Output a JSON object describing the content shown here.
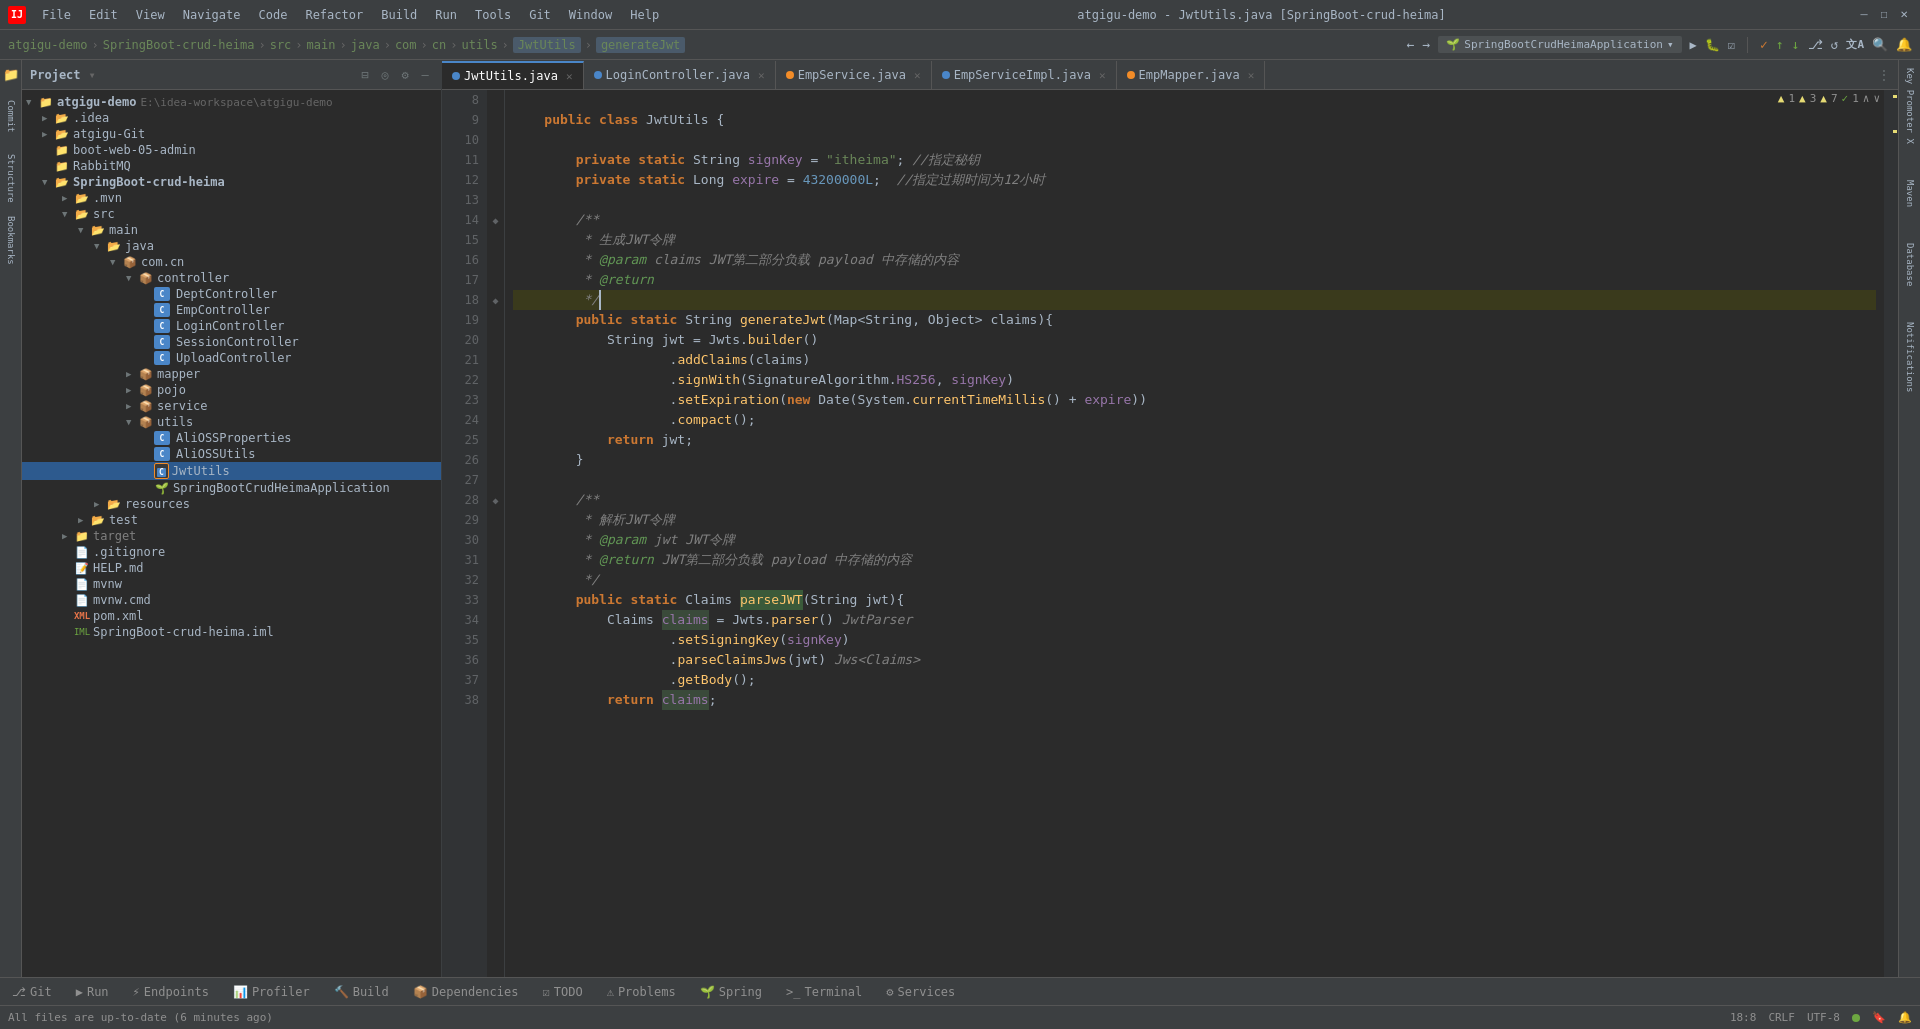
{
  "titlebar": {
    "title": "atgigu-demo - JwtUtils.java [SpringBoot-crud-heima]",
    "menu": [
      "File",
      "Edit",
      "View",
      "Navigate",
      "Code",
      "Refactor",
      "Build",
      "Run",
      "Tools",
      "Git",
      "Window",
      "Help"
    ]
  },
  "breadcrumb": {
    "items": [
      "atgigu-demo",
      "SpringBoot-crud-heima",
      "src",
      "main",
      "java",
      "com",
      "cn",
      "utils",
      "JwtUtils",
      "generateJwt"
    ],
    "run_config": "SpringBootCrudHeimaApplication"
  },
  "tabs": [
    {
      "name": "JwtUtils.java",
      "type": "java",
      "active": true
    },
    {
      "name": "LoginController.java",
      "type": "java",
      "active": false
    },
    {
      "name": "EmpService.java",
      "type": "java",
      "active": false
    },
    {
      "name": "EmpServiceImpl.java",
      "type": "java",
      "active": false
    },
    {
      "name": "EmpMapper.java",
      "type": "java",
      "active": false
    }
  ],
  "warnings": {
    "warn1": "▲ 1",
    "warn3": "▲ 3",
    "warn7": "▲ 7",
    "check1": "✓ 1"
  },
  "project": {
    "title": "Project",
    "root": "atgigu-demo",
    "root_path": "E:\\idea-workspace\\atgigu-demo"
  },
  "tree": [
    {
      "indent": 0,
      "arrow": "▼",
      "icon": "project",
      "label": "atgigu-demo",
      "extra": "E:\\idea-workspace\\atgigu-demo",
      "type": "root"
    },
    {
      "indent": 1,
      "arrow": "▶",
      "icon": "folder",
      "label": ".idea",
      "type": "folder"
    },
    {
      "indent": 1,
      "arrow": "▶",
      "icon": "folder",
      "label": "atgigu-Git",
      "type": "folder"
    },
    {
      "indent": 1,
      "arrow": "",
      "icon": "folder",
      "label": "boot-web-05-admin",
      "type": "folder"
    },
    {
      "indent": 1,
      "arrow": "",
      "icon": "folder",
      "label": "RabbitMQ",
      "type": "folder"
    },
    {
      "indent": 1,
      "arrow": "▼",
      "icon": "folder",
      "label": "SpringBoot-crud-heima",
      "type": "folder"
    },
    {
      "indent": 2,
      "arrow": "▶",
      "icon": "folder",
      "label": ".mvn",
      "type": "folder"
    },
    {
      "indent": 2,
      "arrow": "▼",
      "icon": "folder",
      "label": "src",
      "type": "folder"
    },
    {
      "indent": 3,
      "arrow": "▼",
      "icon": "folder",
      "label": "main",
      "type": "folder"
    },
    {
      "indent": 4,
      "arrow": "▼",
      "icon": "folder",
      "label": "java",
      "type": "folder"
    },
    {
      "indent": 5,
      "arrow": "▼",
      "icon": "folder",
      "label": "com.cn",
      "type": "folder"
    },
    {
      "indent": 6,
      "arrow": "▼",
      "icon": "folder",
      "label": "controller",
      "type": "folder"
    },
    {
      "indent": 7,
      "arrow": "",
      "icon": "java",
      "label": "DeptController",
      "type": "java"
    },
    {
      "indent": 7,
      "arrow": "",
      "icon": "java",
      "label": "EmpController",
      "type": "java"
    },
    {
      "indent": 7,
      "arrow": "",
      "icon": "java",
      "label": "LoginController",
      "type": "java"
    },
    {
      "indent": 7,
      "arrow": "",
      "icon": "java",
      "label": "SessionController",
      "type": "java"
    },
    {
      "indent": 7,
      "arrow": "",
      "icon": "java",
      "label": "UploadController",
      "type": "java"
    },
    {
      "indent": 6,
      "arrow": "▶",
      "icon": "folder",
      "label": "mapper",
      "type": "folder"
    },
    {
      "indent": 6,
      "arrow": "▶",
      "icon": "folder",
      "label": "pojo",
      "type": "folder"
    },
    {
      "indent": 6,
      "arrow": "▶",
      "icon": "folder",
      "label": "service",
      "type": "folder"
    },
    {
      "indent": 6,
      "arrow": "▼",
      "icon": "folder",
      "label": "utils",
      "type": "folder"
    },
    {
      "indent": 7,
      "arrow": "",
      "icon": "java",
      "label": "AliOSSProperties",
      "type": "java"
    },
    {
      "indent": 7,
      "arrow": "",
      "icon": "java",
      "label": "AliOSSUtils",
      "type": "java"
    },
    {
      "indent": 7,
      "arrow": "",
      "icon": "java",
      "label": "JwtUtils",
      "type": "java",
      "selected": true
    },
    {
      "indent": 7,
      "arrow": "",
      "icon": "spring",
      "label": "SpringBootCrudHeimaApplication",
      "type": "spring"
    },
    {
      "indent": 4,
      "arrow": "▶",
      "icon": "folder",
      "label": "resources",
      "type": "folder"
    },
    {
      "indent": 3,
      "arrow": "▶",
      "icon": "folder",
      "label": "test",
      "type": "folder"
    },
    {
      "indent": 2,
      "arrow": "▶",
      "icon": "folder",
      "label": "target",
      "type": "folder"
    },
    {
      "indent": 2,
      "arrow": "",
      "icon": "file",
      "label": ".gitignore",
      "type": "file"
    },
    {
      "indent": 2,
      "arrow": "",
      "icon": "md",
      "label": "HELP.md",
      "type": "file"
    },
    {
      "indent": 2,
      "arrow": "",
      "icon": "file",
      "label": "mvnw",
      "type": "file"
    },
    {
      "indent": 2,
      "arrow": "",
      "icon": "file",
      "label": "mvnw.cmd",
      "type": "file"
    },
    {
      "indent": 2,
      "arrow": "",
      "icon": "xml",
      "label": "pom.xml",
      "type": "xml"
    },
    {
      "indent": 2,
      "arrow": "",
      "icon": "iml",
      "label": "SpringBoot-crud-heima.iml",
      "type": "iml"
    }
  ],
  "code": {
    "lines": [
      {
        "num": "8",
        "gutter": "",
        "content": ""
      },
      {
        "num": "9",
        "gutter": "",
        "content": "    public class JwtUtils {"
      },
      {
        "num": "10",
        "gutter": "",
        "content": ""
      },
      {
        "num": "11",
        "gutter": "",
        "content": "        private static String signKey = \"itheima\"; //指定秘钥"
      },
      {
        "num": "12",
        "gutter": "",
        "content": "        private static Long expire = 43200000L;  //指定过期时间为12小时"
      },
      {
        "num": "13",
        "gutter": "",
        "content": ""
      },
      {
        "num": "14",
        "gutter": "◆",
        "content": "        /**"
      },
      {
        "num": "15",
        "gutter": "",
        "content": "         * 生成JWT令牌"
      },
      {
        "num": "16",
        "gutter": "",
        "content": "         * @param claims JWT第二部分负载 payload 中存储的内容"
      },
      {
        "num": "17",
        "gutter": "",
        "content": "         * @return"
      },
      {
        "num": "18",
        "gutter": "◆",
        "content": "         */"
      },
      {
        "num": "19",
        "gutter": "",
        "content": "        public static String generateJwt(Map<String, Object> claims){"
      },
      {
        "num": "20",
        "gutter": "",
        "content": "            String jwt = Jwts.builder()"
      },
      {
        "num": "21",
        "gutter": "",
        "content": "                    .addClaims(claims)"
      },
      {
        "num": "22",
        "gutter": "",
        "content": "                    .signWith(SignatureAlgorithm.HS256, signKey)"
      },
      {
        "num": "23",
        "gutter": "",
        "content": "                    .setExpiration(new Date(System.currentTimeMillis() + expire))"
      },
      {
        "num": "24",
        "gutter": "",
        "content": "                    .compact();"
      },
      {
        "num": "25",
        "gutter": "",
        "content": "            return jwt;"
      },
      {
        "num": "26",
        "gutter": "",
        "content": "        }"
      },
      {
        "num": "27",
        "gutter": "",
        "content": ""
      },
      {
        "num": "28",
        "gutter": "◆",
        "content": "        /**"
      },
      {
        "num": "29",
        "gutter": "",
        "content": "         * 解析JWT令牌"
      },
      {
        "num": "30",
        "gutter": "",
        "content": "         * @param jwt JWT令牌"
      },
      {
        "num": "31",
        "gutter": "",
        "content": "         * @return JWT第二部分负载 payload 中存储的内容"
      },
      {
        "num": "32",
        "gutter": "",
        "content": "         */"
      },
      {
        "num": "33",
        "gutter": "",
        "content": "        public static Claims parseJWT(String jwt){"
      },
      {
        "num": "34",
        "gutter": "",
        "content": "            Claims claims = Jwts.parser() JwtParser"
      },
      {
        "num": "35",
        "gutter": "",
        "content": "                    .setSigningKey(signKey)"
      },
      {
        "num": "36",
        "gutter": "",
        "content": "                    .parseClaimsJws(jwt) Jws<Claims>"
      },
      {
        "num": "37",
        "gutter": "",
        "content": "                    .getBody();"
      },
      {
        "num": "38",
        "gutter": "",
        "content": "            return claims;"
      }
    ]
  },
  "bottom_tabs": [
    {
      "label": "Git",
      "icon": "⎇",
      "active": false
    },
    {
      "label": "Run",
      "icon": "▶",
      "active": false
    },
    {
      "label": "Endpoints",
      "icon": "⚡",
      "active": false
    },
    {
      "label": "Profiler",
      "icon": "📊",
      "active": false
    },
    {
      "label": "Build",
      "icon": "🔨",
      "active": false
    },
    {
      "label": "Dependencies",
      "icon": "📦",
      "active": false
    },
    {
      "label": "TODO",
      "icon": "✓",
      "active": false
    },
    {
      "label": "Problems",
      "icon": "⚠",
      "active": false
    },
    {
      "label": "Spring",
      "icon": "🌱",
      "active": false
    },
    {
      "label": "Terminal",
      "icon": ">_",
      "active": false
    },
    {
      "label": "Services",
      "icon": "⚙",
      "active": false
    }
  ],
  "statusbar": {
    "message": "All files are up-to-date (6 minutes ago)",
    "position": "18:8",
    "crlf": "CRLF",
    "encoding": "UTF-8",
    "indent": "4"
  },
  "right_panels": [
    "Key Promoter X",
    "Maven",
    "Database",
    "Notifications"
  ]
}
